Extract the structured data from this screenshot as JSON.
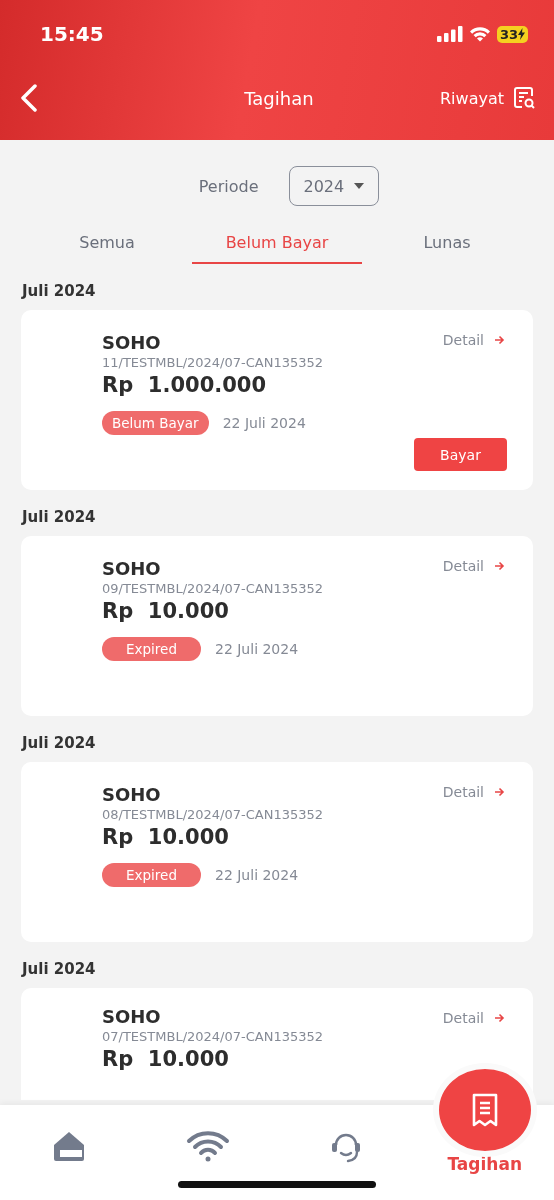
{
  "status_bar": {
    "time": "15:45",
    "battery": "33"
  },
  "header": {
    "title": "Tagihan",
    "history_link": "Riwayat"
  },
  "period": {
    "label": "Periode",
    "value": "2024"
  },
  "tabs": [
    {
      "label": "Semua",
      "selected": false
    },
    {
      "label": "Belum Bayar",
      "selected": true
    },
    {
      "label": "Lunas",
      "selected": false
    }
  ],
  "bills": [
    {
      "month": "Juli 2024",
      "name": "SOHO",
      "number": "11/TESTMBL/2024/07-CAN135352",
      "currency": "Rp",
      "amount": "1.000.000",
      "status": "Belum Bayar",
      "kind": "unpaid",
      "date": "22 Juli 2024",
      "detail": "Detail",
      "pay_button": "Bayar"
    },
    {
      "month": "Juli 2024",
      "name": "SOHO",
      "number": "09/TESTMBL/2024/07-CAN135352",
      "currency": "Rp",
      "amount": "10.000",
      "status": "Expired",
      "kind": "expired",
      "date": "22 Juli 2024",
      "detail": "Detail"
    },
    {
      "month": "Juli 2024",
      "name": "SOHO",
      "number": "08/TESTMBL/2024/07-CAN135352",
      "currency": "Rp",
      "amount": "10.000",
      "status": "Expired",
      "kind": "expired",
      "date": "22 Juli 2024",
      "detail": "Detail"
    },
    {
      "month": "Juli 2024",
      "name": "SOHO",
      "number": "07/TESTMBL/2024/07-CAN135352",
      "currency": "Rp",
      "amount": "10.000",
      "detail": "Detail"
    }
  ],
  "bottom_nav": [
    {
      "kind": "home",
      "selected": false
    },
    {
      "kind": "wifi",
      "selected": false
    },
    {
      "kind": "support",
      "selected": false
    },
    {
      "kind": "bill",
      "selected": true,
      "label": "Tagihan"
    }
  ]
}
